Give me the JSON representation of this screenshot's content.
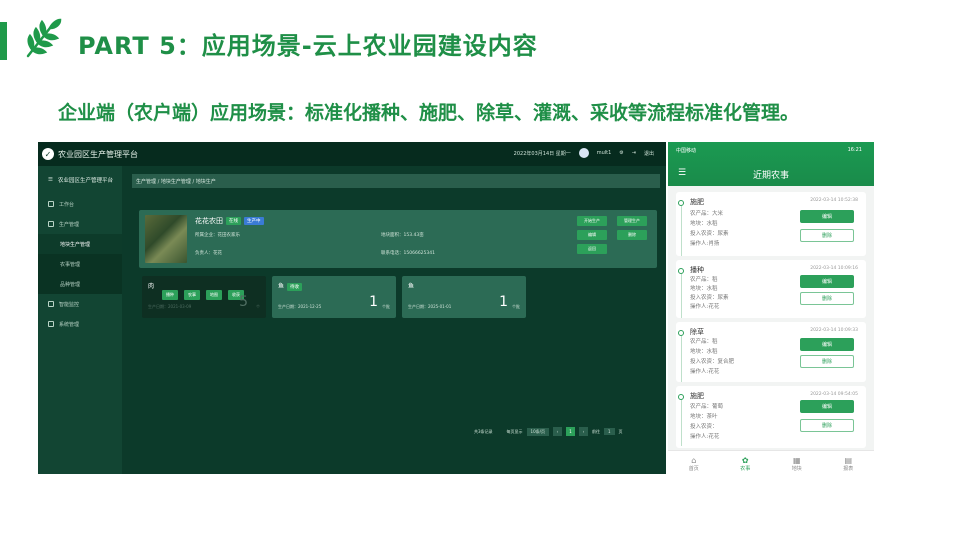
{
  "slide": {
    "title": "PART 5：应用场景-云上农业园建设内容",
    "subtitle": "企业端（农户端）应用场景：标准化播种、施肥、除草、灌溉、采收等流程标准化管理。"
  },
  "desktop": {
    "app_title": "农业园区生产管理平台",
    "header_date": "2022年03月14日 星期一",
    "user": "mult1",
    "logout": "退出",
    "sidebar": {
      "header": "农业园区生产管理平台",
      "items": [
        {
          "label": "工作台"
        },
        {
          "label": "生产管理"
        },
        {
          "label": "地块生产管理"
        },
        {
          "label": "农事管理"
        },
        {
          "label": "品种管理"
        },
        {
          "label": "智能监控"
        },
        {
          "label": "系统管理"
        }
      ]
    },
    "breadcrumb": "生产管理 / 地块生产管理 / 地块生产",
    "farm": {
      "name": "花花农田",
      "tag1": "在线",
      "tag2": "生产中",
      "field1": "所属企业：花田农家乐",
      "field2": "地块面积：153.43亩",
      "field3": "负责人：花花",
      "field4": "联系电话：15066625341",
      "buttons": [
        "开始生产",
        "管理生产",
        "编辑",
        "删除",
        "返回"
      ]
    },
    "crop_cards": [
      {
        "title": "肉",
        "buttons": [
          "播种",
          "农事",
          "地图",
          "收获"
        ],
        "date": "生产日期：2021-03-09",
        "count": "5",
        "unit": "个"
      },
      {
        "title": "鱼",
        "tag": "待收",
        "date": "生产日期：2021-12-25",
        "count": "1",
        "unit": "个批"
      },
      {
        "title": "鱼",
        "date": "生产日期：2025-01-01",
        "count": "1",
        "unit": "个批"
      }
    ],
    "pager": {
      "total": "共3条记录",
      "per_page_label": "每页显示",
      "per_page": "10条/页",
      "page": "1",
      "goto": "前往",
      "goto_page": "1",
      "page_suffix": "页"
    }
  },
  "phone": {
    "status_left": "中国移动",
    "status_right": "16:21",
    "title": "近期农事",
    "records": [
      {
        "name": "施肥",
        "time": "2022-03-14 10:52:38",
        "crop": "农产品：大米",
        "plot": "地块：水稻",
        "input": "投入农资：尿素",
        "operator": "操作人:肖扬",
        "edit": "编辑",
        "del": "删除"
      },
      {
        "name": "播种",
        "time": "2022-03-14 10:09:16",
        "crop": "农产品：稻",
        "plot": "地块：水稻",
        "input": "投入农资：尿素",
        "operator": "操作人:花花",
        "edit": "编辑",
        "del": "删除"
      },
      {
        "name": "除草",
        "time": "2022-03-14 10:09:33",
        "crop": "农产品：稻",
        "plot": "地块：水稻",
        "input": "投入农资：复合肥",
        "operator": "操作人:花花",
        "edit": "编辑",
        "del": "删除"
      },
      {
        "name": "施肥",
        "time": "2022-03-14 09:54:05",
        "crop": "农产品：葡萄",
        "plot": "地块：茶叶",
        "input": "投入农资：",
        "operator": "操作人:花花",
        "edit": "编辑",
        "del": "删除"
      }
    ],
    "nav": [
      {
        "label": "首页",
        "icon": "home-icon"
      },
      {
        "label": "农事",
        "icon": "tractor-icon"
      },
      {
        "label": "地块",
        "icon": "grid-icon"
      },
      {
        "label": "报表",
        "icon": "report-icon"
      }
    ]
  },
  "colors": {
    "accent": "#1f8f47",
    "dark_panel": "#0c3a2a",
    "phone_header": "#1b9a52"
  }
}
